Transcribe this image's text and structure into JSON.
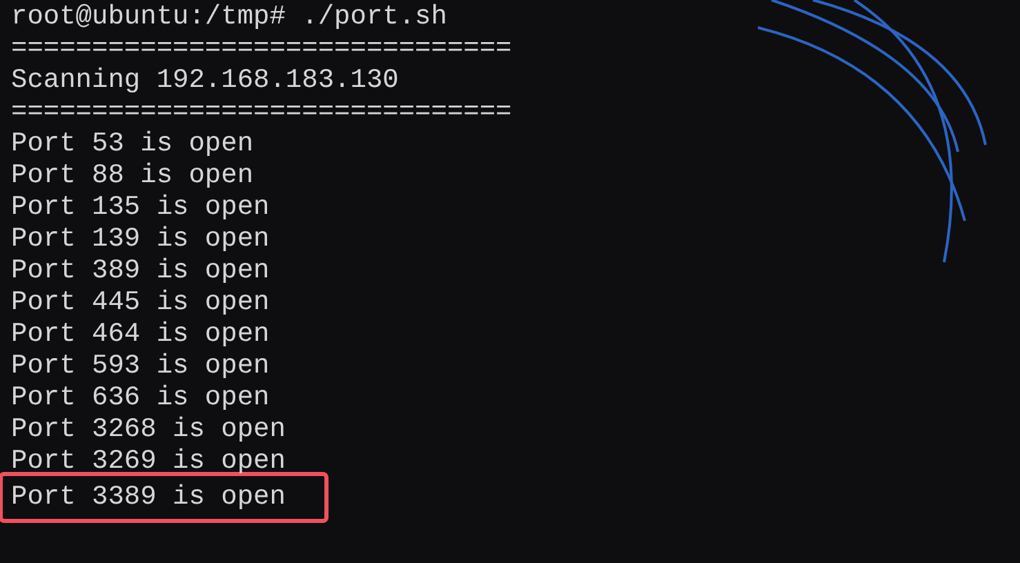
{
  "terminal": {
    "lines": [
      {
        "text": "root@ubuntu:/tmp# ./port.sh",
        "highlighted": false
      },
      {
        "text": "===============================",
        "highlighted": false
      },
      {
        "text": "Scanning 192.168.183.130",
        "highlighted": false
      },
      {
        "text": "===============================",
        "highlighted": false
      },
      {
        "text": "Port 53 is open",
        "highlighted": false
      },
      {
        "text": "Port 88 is open",
        "highlighted": false
      },
      {
        "text": "Port 135 is open",
        "highlighted": false
      },
      {
        "text": "Port 139 is open",
        "highlighted": false
      },
      {
        "text": "Port 389 is open",
        "highlighted": false
      },
      {
        "text": "Port 445 is open",
        "highlighted": false
      },
      {
        "text": "Port 464 is open",
        "highlighted": false
      },
      {
        "text": "Port 593 is open",
        "highlighted": false
      },
      {
        "text": "Port 636 is open",
        "highlighted": false
      },
      {
        "text": "Port 3268 is open",
        "highlighted": false
      },
      {
        "text": "Port 3269 is open",
        "highlighted": false
      },
      {
        "text": "Port 3389 is open",
        "highlighted": true
      }
    ]
  }
}
